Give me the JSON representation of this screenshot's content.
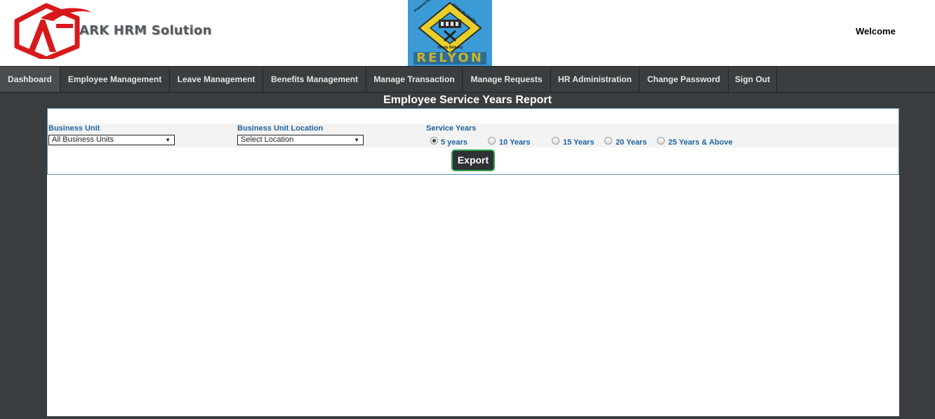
{
  "header": {
    "brand_name": "ARK HRM Solution",
    "center_logo": {
      "top_text": "Powered By Excellence",
      "side_text": "Driven By Quality",
      "bottom_text": "Timely Delivery",
      "name": "RELYON"
    },
    "welcome_text": "Welcome"
  },
  "nav": {
    "items": [
      {
        "label": "Dashboard"
      },
      {
        "label": "Employee Management"
      },
      {
        "label": "Leave Management"
      },
      {
        "label": "Benefits Management"
      },
      {
        "label": "Manage Transaction"
      },
      {
        "label": "Manage Requests"
      },
      {
        "label": "HR Administration"
      },
      {
        "label": "Change Password"
      },
      {
        "label": "Sign Out"
      }
    ]
  },
  "page": {
    "title": "Employee Service Years Report"
  },
  "filters": {
    "business_unit": {
      "label": "Business Unit",
      "selected": "All Business Units"
    },
    "business_unit_location": {
      "label": "Business Unit Location",
      "selected": "Select Location"
    },
    "service_years": {
      "label": "Service Years",
      "options": [
        {
          "label": "5 years",
          "checked": true
        },
        {
          "label": "10 Years",
          "checked": false
        },
        {
          "label": "15 Years",
          "checked": false
        },
        {
          "label": "20 Years",
          "checked": false
        },
        {
          "label": "25 Years & Above",
          "checked": false
        }
      ]
    }
  },
  "actions": {
    "export_label": "Export"
  },
  "colors": {
    "label_blue": "#1e63a0",
    "nav_bg": "#3b3e40",
    "export_border": "#2fa04a",
    "logo_red": "#d8191c"
  }
}
